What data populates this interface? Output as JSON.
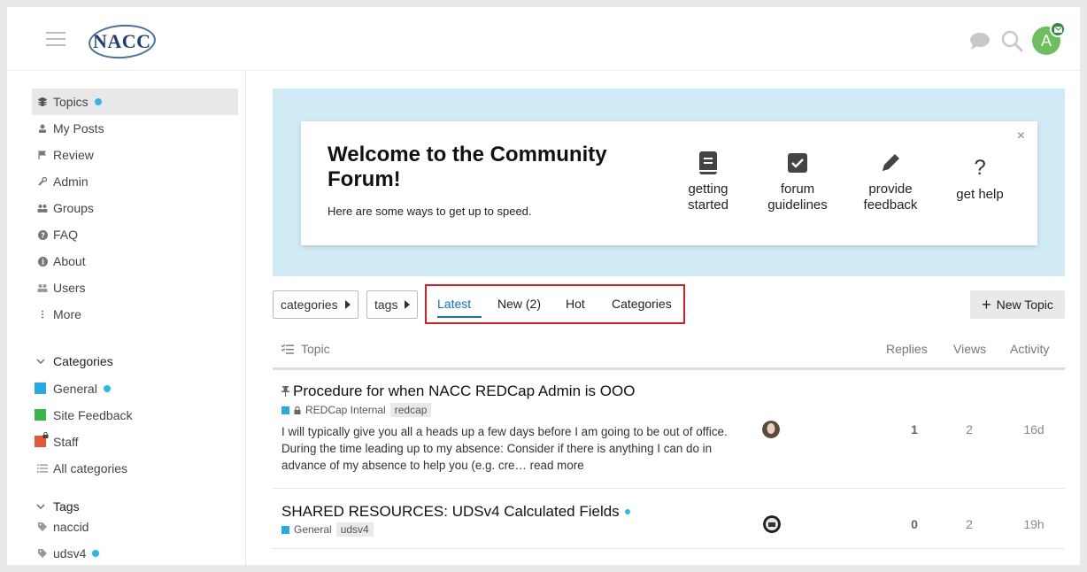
{
  "header": {
    "logo_text": "NACC",
    "avatar_letter": "A"
  },
  "sidebar": {
    "items": [
      {
        "label": "Topics",
        "icon": "layers-icon"
      },
      {
        "label": "My Posts",
        "icon": "user-icon"
      },
      {
        "label": "Review",
        "icon": "flag-icon"
      },
      {
        "label": "Admin",
        "icon": "wrench-icon"
      },
      {
        "label": "Groups",
        "icon": "users-icon"
      },
      {
        "label": "FAQ",
        "icon": "question-circle-icon"
      },
      {
        "label": "About",
        "icon": "info-circle-icon"
      },
      {
        "label": "Users",
        "icon": "user-friends-icon"
      },
      {
        "label": "More",
        "icon": "ellipsis-vertical-icon"
      }
    ],
    "categories_heading": "Categories",
    "categories": [
      {
        "label": "General",
        "color": "#25aae1"
      },
      {
        "label": "Site Feedback",
        "color": "#3ab54a"
      },
      {
        "label": "Staff",
        "color": "#e45735"
      },
      {
        "label": "All categories"
      }
    ],
    "tags_heading": "Tags",
    "tags": [
      {
        "label": "naccid"
      },
      {
        "label": "udsv4"
      }
    ]
  },
  "welcome": {
    "title": "Welcome to the Community Forum!",
    "subtitle": "Here are some ways to get up to speed.",
    "close": "×",
    "links": [
      {
        "label_line1": "getting",
        "label_line2": "started",
        "icon": "book-icon"
      },
      {
        "label_line1": "forum",
        "label_line2": "guidelines",
        "icon": "check-square-icon"
      },
      {
        "label_line1": "provide",
        "label_line2": "feedback",
        "icon": "pencil-icon"
      },
      {
        "label_line1": "get help",
        "label_line2": "",
        "icon": "question-icon"
      }
    ]
  },
  "nav": {
    "categories_filter": "categories",
    "tags_filter": "tags",
    "tabs": [
      "Latest",
      "New (2)",
      "Hot",
      "Categories"
    ],
    "active_tab": "Latest",
    "new_topic": "New Topic"
  },
  "table": {
    "headers": {
      "topic": "Topic",
      "replies": "Replies",
      "views": "Views",
      "activity": "Activity"
    },
    "rows": [
      {
        "title": "Procedure for when NACC REDCap Admin is OOO",
        "pinned": true,
        "category": "REDCap Internal",
        "category_color": "#25aae1",
        "locked": true,
        "tag": "redcap",
        "excerpt": "I will typically give you all a heads up a few days before I am going to be out of office. During the time leading up to my absence: Consider if there is anything I can do in advance of my absence to help you (e.g. cre…",
        "read_more": "read more",
        "replies": "1",
        "views": "2",
        "activity": "16d"
      },
      {
        "title": "SHARED RESOURCES: UDSv4 Calculated Fields",
        "pinned": false,
        "category": "General",
        "category_color": "#25aae1",
        "tag": "udsv4",
        "replies": "0",
        "views": "2",
        "activity": "19h"
      }
    ]
  }
}
